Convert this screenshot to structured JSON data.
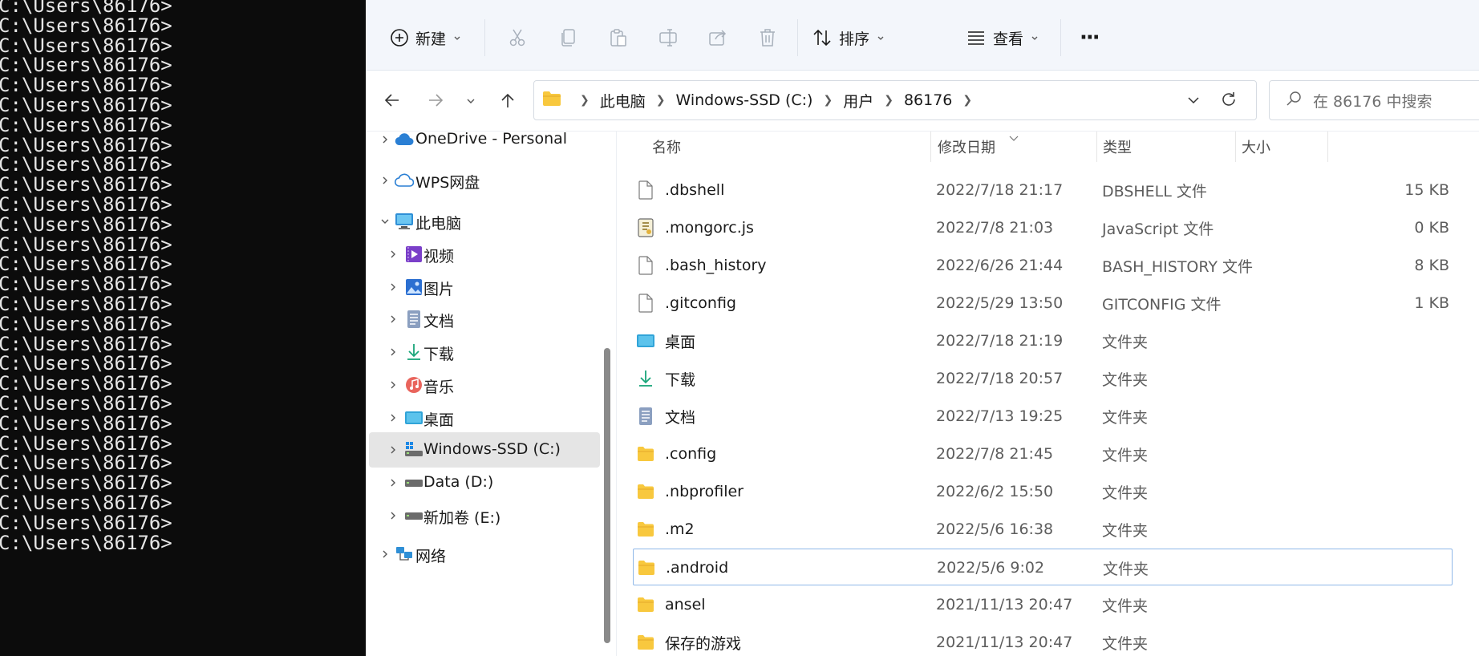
{
  "terminal": {
    "lines": [
      "C:\\Users\\86176>",
      "C:\\Users\\86176>",
      "C:\\Users\\86176>",
      "C:\\Users\\86176>",
      "C:\\Users\\86176>",
      "C:\\Users\\86176>",
      "C:\\Users\\86176>",
      "C:\\Users\\86176>",
      "C:\\Users\\86176>",
      "C:\\Users\\86176>",
      "C:\\Users\\86176>",
      "C:\\Users\\86176>",
      "C:\\Users\\86176>",
      "C:\\Users\\86176>",
      "C:\\Users\\86176>",
      "C:\\Users\\86176>",
      "C:\\Users\\86176>",
      "C:\\Users\\86176>",
      "C:\\Users\\86176>",
      "C:\\Users\\86176>",
      "C:\\Users\\86176>",
      "C:\\Users\\86176>",
      "C:\\Users\\86176>",
      "C:\\Users\\86176>",
      "C:\\Users\\86176>",
      "C:\\Users\\86176>",
      "C:\\Users\\86176>",
      "C:\\Users\\86176>"
    ]
  },
  "toolbar": {
    "new_label": "新建",
    "sort_label": "排序",
    "view_label": "查看",
    "more_label": "···"
  },
  "navbar": {
    "breadcrumbs": [
      "此电脑",
      "Windows-SSD (C:)",
      "用户",
      "86176"
    ],
    "search_placeholder": "在 86176 中搜索"
  },
  "sidebar": {
    "items": [
      {
        "label": "OneDrive - Personal",
        "icon": "cloud-icon",
        "expanded": false
      },
      {
        "label": "WPS网盘",
        "icon": "wps-cloud-icon",
        "expanded": false
      },
      {
        "label": "此电脑",
        "icon": "computer-icon",
        "expanded": true
      },
      {
        "label": "视频",
        "icon": "video-icon",
        "expanded": false
      },
      {
        "label": "图片",
        "icon": "pictures-icon",
        "expanded": false
      },
      {
        "label": "文档",
        "icon": "documents-icon",
        "expanded": false
      },
      {
        "label": "下载",
        "icon": "download-icon",
        "expanded": false
      },
      {
        "label": "音乐",
        "icon": "music-icon",
        "expanded": false
      },
      {
        "label": "桌面",
        "icon": "desktop-icon",
        "expanded": false
      },
      {
        "label": "Windows-SSD (C:)",
        "icon": "system-drive-icon",
        "expanded": false,
        "selected": true
      },
      {
        "label": "Data (D:)",
        "icon": "drive-icon",
        "expanded": false
      },
      {
        "label": "新加卷 (E:)",
        "icon": "drive-icon",
        "expanded": false
      },
      {
        "label": "网络",
        "icon": "network-icon",
        "expanded": false
      }
    ]
  },
  "filelist": {
    "columns": {
      "name": "名称",
      "date": "修改日期",
      "type": "类型",
      "size": "大小"
    },
    "rows": [
      {
        "name": ".dbshell",
        "date": "2022/7/18 21:17",
        "type": "DBSHELL 文件",
        "size": "15 KB",
        "icon": "file-icon"
      },
      {
        "name": ".mongorc.js",
        "date": "2022/7/8 21:03",
        "type": "JavaScript 文件",
        "size": "0 KB",
        "icon": "script-icon"
      },
      {
        "name": ".bash_history",
        "date": "2022/6/26 21:44",
        "type": "BASH_HISTORY 文件",
        "size": "8 KB",
        "icon": "file-icon"
      },
      {
        "name": ".gitconfig",
        "date": "2022/5/29 13:50",
        "type": "GITCONFIG 文件",
        "size": "1 KB",
        "icon": "file-icon"
      },
      {
        "name": "桌面",
        "date": "2022/7/18 21:19",
        "type": "文件夹",
        "size": "",
        "icon": "desktop-icon"
      },
      {
        "name": "下载",
        "date": "2022/7/18 20:57",
        "type": "文件夹",
        "size": "",
        "icon": "download-icon"
      },
      {
        "name": "文档",
        "date": "2022/7/13 19:25",
        "type": "文件夹",
        "size": "",
        "icon": "documents-icon"
      },
      {
        "name": ".config",
        "date": "2022/7/8 21:45",
        "type": "文件夹",
        "size": "",
        "icon": "folder-icon"
      },
      {
        "name": ".nbprofiler",
        "date": "2022/6/2 15:50",
        "type": "文件夹",
        "size": "",
        "icon": "folder-icon"
      },
      {
        "name": ".m2",
        "date": "2022/5/6 16:38",
        "type": "文件夹",
        "size": "",
        "icon": "folder-icon"
      },
      {
        "name": ".android",
        "date": "2022/5/6 9:02",
        "type": "文件夹",
        "size": "",
        "icon": "folder-icon",
        "focused": true
      },
      {
        "name": "ansel",
        "date": "2021/11/13 20:47",
        "type": "文件夹",
        "size": "",
        "icon": "folder-icon"
      },
      {
        "name": "保存的游戏",
        "date": "2021/11/13 20:47",
        "type": "文件夹",
        "size": "",
        "icon": "folder-icon"
      }
    ]
  },
  "colors": {
    "terminal_bg": "#0c0c0c",
    "toolbar_bg": "#f3f6fb",
    "selection": "#e5e5e5",
    "focus_border": "#8fb8e8",
    "folder": "#f8c83e"
  }
}
